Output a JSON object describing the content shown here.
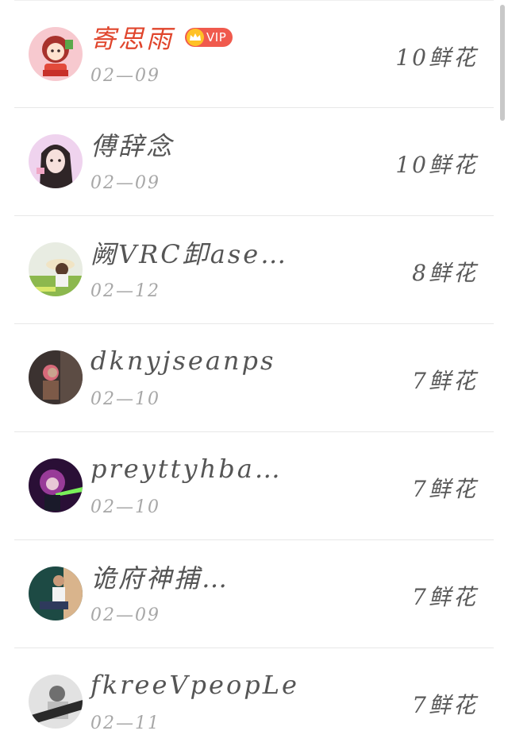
{
  "rows": [
    {
      "name": "寄思雨",
      "date": "02—09",
      "flowers": "10鲜花",
      "vip": "VIP"
    },
    {
      "name": "傅辞念",
      "date": "02—09",
      "flowers": "10鲜花"
    },
    {
      "name": "阙VRC卸ase…",
      "date": "02—12",
      "flowers": "8鲜花"
    },
    {
      "name": "dknyjseanps",
      "date": "02—10",
      "flowers": "7鲜花"
    },
    {
      "name": "preyttyhba…",
      "date": "02—10",
      "flowers": "7鲜花"
    },
    {
      "name": "诡府神捕…",
      "date": "02—09",
      "flowers": "7鲜花"
    },
    {
      "name": "fkreeVpeopLe",
      "date": "02—11",
      "flowers": "7鲜花"
    }
  ],
  "avatar_icons": [
    "cartoon-girl-avatar",
    "anime-girl-avatar",
    "straw-hat-field-avatar",
    "dark-portrait-avatar",
    "neon-light-avatar",
    "seated-man-avatar",
    "bw-portrait-avatar"
  ],
  "colors": {
    "vip_name": "#e0452c",
    "name": "#555555",
    "date": "#a7a7a7",
    "vip_badge": "#f05a4d",
    "crown": "#ffc125"
  }
}
